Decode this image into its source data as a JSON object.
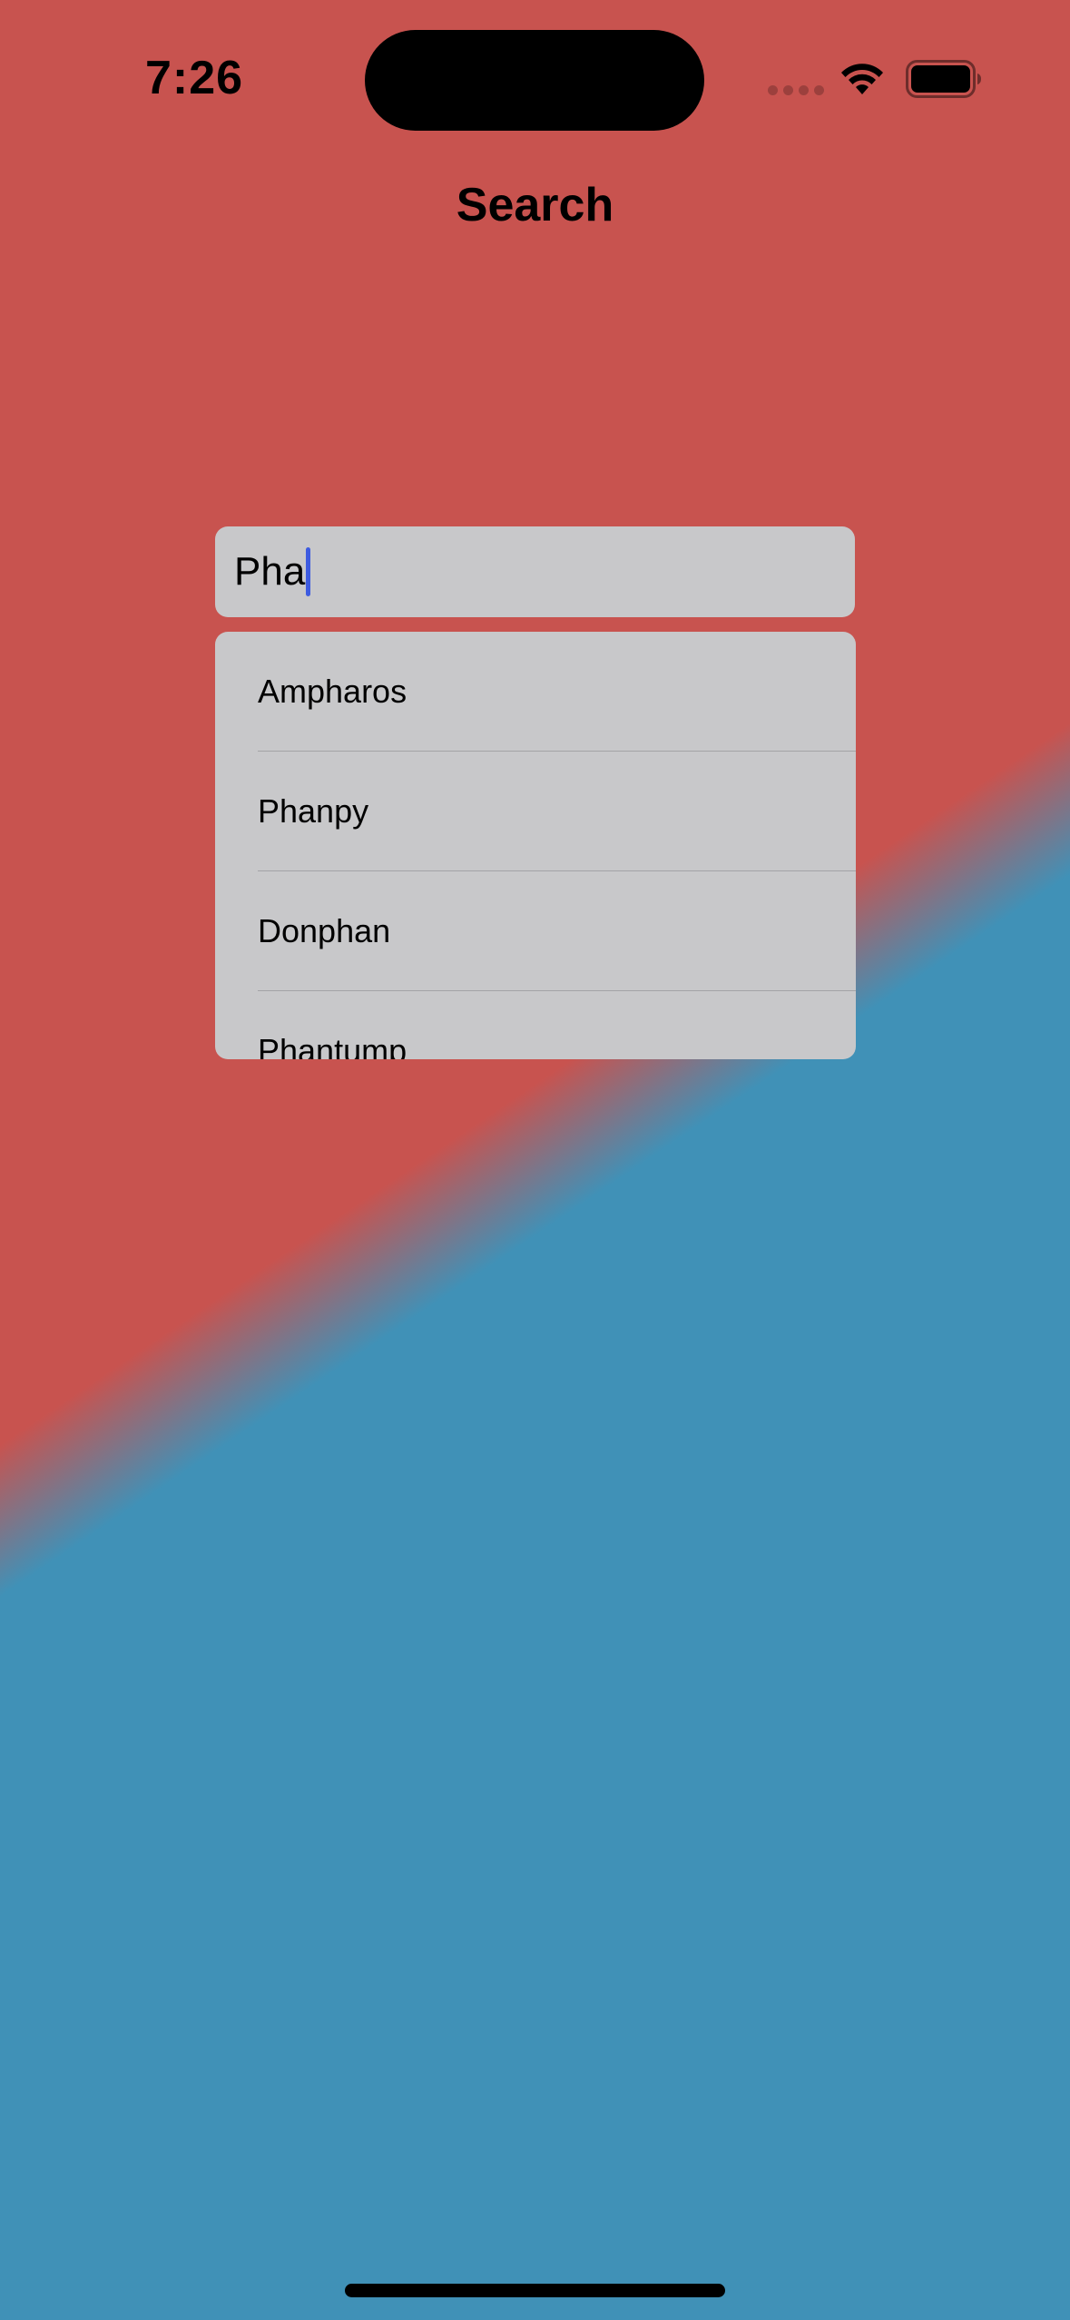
{
  "status_bar": {
    "time": "7:26"
  },
  "nav": {
    "title": "Search"
  },
  "search": {
    "value": "Pha"
  },
  "suggestions": [
    "Ampharos",
    "Phanpy",
    "Donphan",
    "Phantump"
  ],
  "colors": {
    "gradient_top": "#c8534f",
    "gradient_bottom": "#4091b7",
    "field_background": "#c8c8ca",
    "caret": "#3d5be0"
  },
  "icons": {
    "signal": "cellular-signal-icon",
    "wifi": "wifi-icon",
    "battery": "battery-icon"
  }
}
